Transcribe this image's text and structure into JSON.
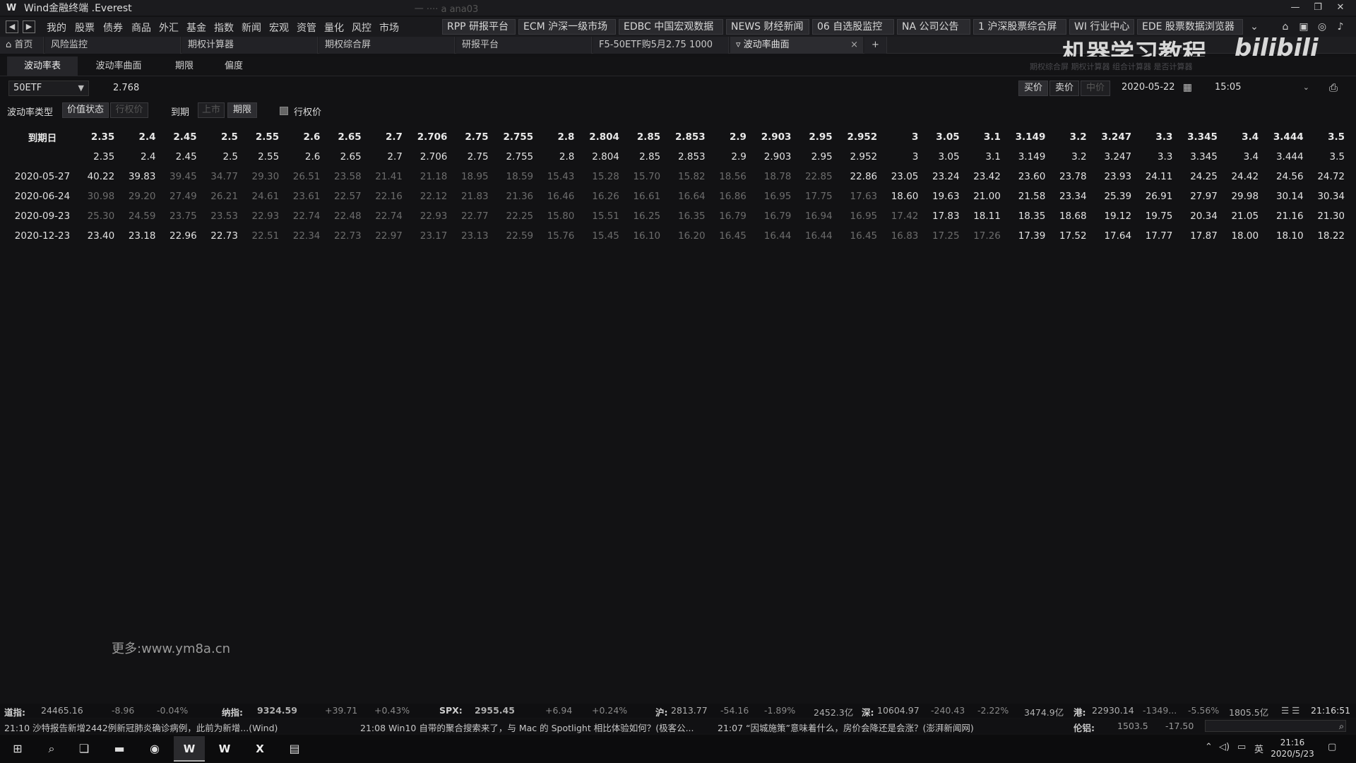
{
  "window": {
    "logo": "W",
    "title": "Wind金融终端 .Everest",
    "faint_title": "一 ···· a ana03"
  },
  "menu": {
    "items": [
      "我的",
      "股票",
      "债券",
      "商品",
      "外汇",
      "基金",
      "指数",
      "新闻",
      "宏观",
      "资管",
      "量化",
      "风控",
      "市场"
    ],
    "quick_buttons": [
      "RPP 研报平台",
      "ECM 沪深一级市场",
      "EDBC 中国宏观数据",
      "NEWS 财经新闻",
      "06 自选股监控",
      "NA 公司公告",
      "1 沪深股票综合屏",
      "WI 行业中心",
      "EDE 股票数据浏览器"
    ]
  },
  "tabs": {
    "home": "首页",
    "items": [
      "风险监控",
      "期权计算器",
      "期权综合屏",
      "研报平台",
      "F5-50ETF购5月2.75 1000",
      "波动率曲面"
    ],
    "add": "+"
  },
  "watermark": {
    "text": "机器学习教程",
    "brand": "bilibili",
    "faint_links": "期权综合屏  期权计算器  组合计算器  是否计算器"
  },
  "subtabs": [
    "波动率表",
    "波动率曲面",
    "期限",
    "偏度"
  ],
  "toolbar": {
    "underlying": "50ETF",
    "price": "2.768",
    "bid": "买价",
    "ask": "卖价",
    "mid": "中价",
    "date": "2020-05-22",
    "time": "15:05"
  },
  "toolbar2": {
    "vol_type_label": "波动率类型",
    "moneyness": "价值状态",
    "strike_btn": "行权价",
    "expiry_label": "到期",
    "listed": "上市",
    "tenor": "期限",
    "check_label": "行权价"
  },
  "table": {
    "date_header": "到期日",
    "strikes": [
      "2.35",
      "2.4",
      "2.45",
      "2.5",
      "2.55",
      "2.6",
      "2.65",
      "2.7",
      "2.706",
      "2.75",
      "2.755",
      "2.8",
      "2.804",
      "2.85",
      "2.853",
      "2.9",
      "2.903",
      "2.95",
      "2.952",
      "3",
      "3.05",
      "3.1",
      "3.149",
      "3.2",
      "3.247",
      "3.3",
      "3.345",
      "3.4",
      "3.444",
      "3.5"
    ],
    "rows": [
      {
        "date": "2020-05-27",
        "values": [
          "40.22",
          "39.83",
          "39.45",
          "34.77",
          "29.30",
          "26.51",
          "23.58",
          "21.41",
          "21.18",
          "18.95",
          "18.59",
          "15.43",
          "15.28",
          "15.70",
          "15.82",
          "18.56",
          "18.78",
          "22.85",
          "22.86",
          "23.05",
          "23.24",
          "23.42",
          "23.60",
          "23.78",
          "23.93",
          "24.11",
          "24.25",
          "24.42",
          "24.56",
          "24.72"
        ]
      },
      {
        "date": "2020-06-24",
        "values": [
          "30.98",
          "29.20",
          "27.49",
          "26.21",
          "24.61",
          "23.61",
          "22.57",
          "22.16",
          "22.12",
          "21.83",
          "21.36",
          "16.46",
          "16.26",
          "16.61",
          "16.64",
          "16.86",
          "16.95",
          "17.75",
          "17.63",
          "18.60",
          "19.63",
          "21.00",
          "21.58",
          "23.34",
          "25.39",
          "26.91",
          "27.97",
          "29.98",
          "30.14",
          "30.34"
        ]
      },
      {
        "date": "2020-09-23",
        "values": [
          "25.30",
          "24.59",
          "23.75",
          "23.53",
          "22.93",
          "22.74",
          "22.48",
          "22.74",
          "22.93",
          "22.77",
          "22.25",
          "15.80",
          "15.51",
          "16.25",
          "16.35",
          "16.79",
          "16.79",
          "16.94",
          "16.95",
          "17.42",
          "17.83",
          "18.11",
          "18.35",
          "18.68",
          "19.12",
          "19.75",
          "20.34",
          "21.05",
          "21.16",
          "21.30"
        ]
      },
      {
        "date": "2020-12-23",
        "values": [
          "23.40",
          "23.18",
          "22.96",
          "22.73",
          "22.51",
          "22.34",
          "22.73",
          "22.97",
          "23.17",
          "23.13",
          "22.59",
          "15.76",
          "15.45",
          "16.10",
          "16.20",
          "16.45",
          "16.44",
          "16.44",
          "16.45",
          "16.83",
          "17.25",
          "17.26",
          "17.39",
          "17.52",
          "17.64",
          "17.77",
          "17.87",
          "18.00",
          "18.10",
          "18.22"
        ]
      }
    ]
  },
  "site_mark": "更多:www.ym8a.cn",
  "statusbar": {
    "items": [
      {
        "label": "道指:",
        "value": "24465.16",
        "chg": "-8.96",
        "pct": "-0.04%"
      },
      {
        "label": "纳指:",
        "value": "9324.59",
        "chg": "+39.71",
        "pct": "+0.43%"
      },
      {
        "label": "SPX:",
        "value": "2955.45",
        "chg": "+6.94",
        "pct": "+0.24%"
      },
      {
        "label": "沪:",
        "value": "2813.77",
        "chg": "-54.16",
        "pct": "-1.89%",
        "amt": "2452.3亿"
      },
      {
        "label": "深:",
        "value": "10604.97",
        "chg": "-240.43",
        "pct": "-2.22%",
        "amt": "3474.9亿"
      },
      {
        "label": "港:",
        "value": "22930.14",
        "chg": "-1349...",
        "pct": "-5.56%",
        "amt": "1805.5亿"
      }
    ],
    "clock": "21:16:51"
  },
  "news": {
    "items": [
      "21:10  沙特报告新增2442例新冠肺炎确诊病例，此前为新增...(Wind)",
      "21:08  Win10 自带的聚合搜索来了，与 Mac 的 Spotlight 相比体验如何？(极客公...",
      "21:07  “因城施策”意味着什么，房价会降还是会涨？(澎湃新闻网)"
    ],
    "gold_label": "伦铝:",
    "gold_value": "1503.5",
    "gold_chg": "-17.50"
  },
  "taskbar": {
    "apps": [
      "W",
      "W",
      "X"
    ],
    "tray": "英",
    "time": "21:16",
    "date": "2020/5/23"
  }
}
